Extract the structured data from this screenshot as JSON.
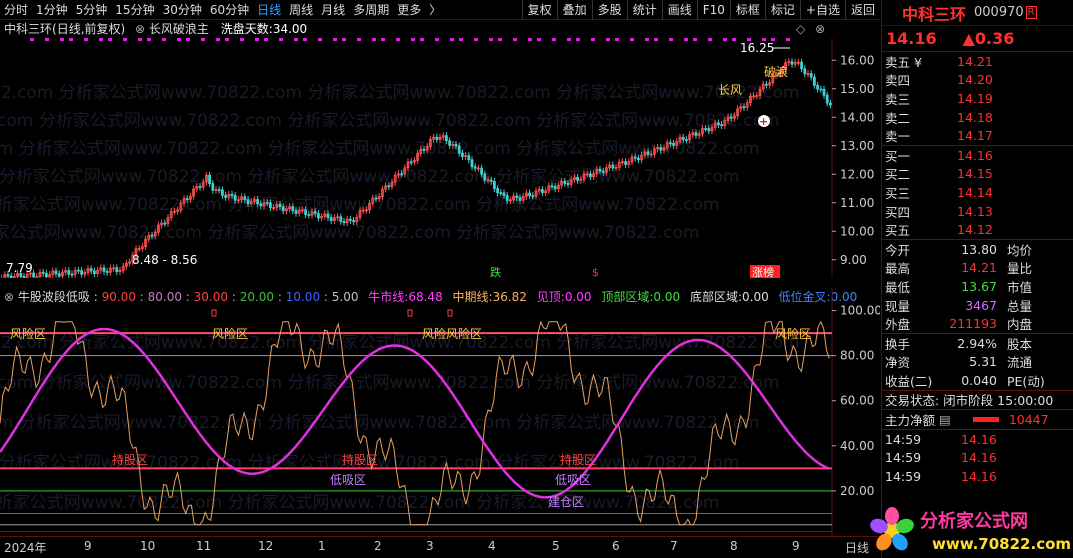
{
  "toolbar": {
    "left_tabs": [
      "分时",
      "1分钟",
      "5分钟",
      "15分钟",
      "30分钟",
      "60分钟",
      "日线",
      "周线",
      "月线",
      "多周期",
      "更多"
    ],
    "active": "日线",
    "more_arrow": "〉",
    "right_tabs": [
      "复权",
      "叠加",
      "多股",
      "统计",
      "画线",
      "F10",
      "标框",
      "标记",
      "+自选",
      "返回"
    ]
  },
  "kheader": {
    "stock": "中科三环",
    "mode": "(日线,前复权)",
    "indicator": "长风破浪主",
    "wash_label": "洗盘天数:",
    "wash_value": "34.00"
  },
  "kchart": {
    "y_ticks": [
      "16.00",
      "15.00",
      "14.00",
      "13.00",
      "12.00",
      "11.00",
      "10.00",
      "9.00"
    ],
    "high_label": "16.25",
    "low_label": "7.79",
    "range_label": "8.48 - 8.56",
    "tags": {
      "changfeng": "长风",
      "polang": "破浪",
      "die": "跌",
      "zhang": "涨榜"
    },
    "watermark": "22.com 分析家公式网www.70822.com 分析家公式网www.70822.com 分析家公式网www.70822.com"
  },
  "iheader": {
    "name": "牛股波段低吸",
    "levels": [
      {
        "v": "90.00",
        "c": "#ff4040"
      },
      {
        "v": "80.00",
        "c": "#c080c0"
      },
      {
        "v": "30.00",
        "c": "#ff4040"
      },
      {
        "v": "20.00",
        "c": "#40c040"
      },
      {
        "v": "10.00",
        "c": "#4060ff"
      },
      {
        "v": "5.00",
        "c": "#c0c0c0"
      }
    ],
    "niushi_label": "牛市线:",
    "niushi": "68.48",
    "zhongqi_label": "中期线:",
    "zhongqi": "36.82",
    "jianding_label": "见顶:",
    "jianding": "0.00",
    "dingbu_label": "顶部区域:",
    "dingbu": "0.00",
    "dibu_label": "底部区域:",
    "dibu": "0.00",
    "diwei_label": "低位金叉:",
    "diwei": "0.00"
  },
  "ind": {
    "y_ticks": [
      "100.00",
      "80.00",
      "60.00",
      "40.00",
      "20.00"
    ],
    "labels": {
      "risk": "风险区",
      "risk2": "风险区",
      "risk3": "风险风险区",
      "risk4": "风险区",
      "low": "低吸区",
      "low2": "低吸区",
      "build": "建仓区",
      "hold": "持股区",
      "low3": "低吸区",
      "hold2": "持股区",
      "hold3": "持股区"
    }
  },
  "xaxis": {
    "labels": [
      "2024年",
      "9",
      "10",
      "11",
      "12",
      "1",
      "2",
      "3",
      "4",
      "5",
      "6",
      "7",
      "8",
      "9"
    ],
    "tail": "日线"
  },
  "rp": {
    "name": "中科三环",
    "code": "000970",
    "badge": "R",
    "price": "14.16",
    "change": "▲0.36",
    "asks": [
      {
        "l": "卖五 ¥",
        "v": "14.21"
      },
      {
        "l": "卖四",
        "v": "14.20"
      },
      {
        "l": "卖三",
        "v": "14.19"
      },
      {
        "l": "卖二",
        "v": "14.18"
      },
      {
        "l": "卖一",
        "v": "14.17"
      }
    ],
    "bids": [
      {
        "l": "买一",
        "v": "14.16"
      },
      {
        "l": "买二",
        "v": "14.15"
      },
      {
        "l": "买三",
        "v": "14.14"
      },
      {
        "l": "买四",
        "v": "14.13"
      },
      {
        "l": "买五",
        "v": "14.12"
      }
    ],
    "stats": [
      {
        "l": "今开",
        "v": "13.80",
        "c": "#ddd",
        "l2": "均价"
      },
      {
        "l": "最高",
        "v": "14.21",
        "c": "#ff3030",
        "l2": "量比"
      },
      {
        "l": "最低",
        "v": "13.67",
        "c": "#40e040",
        "l2": "市值"
      },
      {
        "l": "现量",
        "v": "3467",
        "c": "#d070ff",
        "l2": "总量"
      },
      {
        "l": "外盘",
        "v": "211193",
        "c": "#ff3030",
        "l2": "内盘"
      }
    ],
    "stats2": [
      {
        "l": "换手",
        "v": "2.94%",
        "c": "#ddd",
        "l2": "股本"
      },
      {
        "l": "净资",
        "v": "5.31",
        "c": "#ddd",
        "l2": "流通"
      },
      {
        "l": "收益(二)",
        "v": "0.040",
        "c": "#ddd",
        "l2": "PE(动)"
      }
    ],
    "trade_state": "交易状态: 闭市阶段 15:00:00",
    "main_flow_label": "主力净额",
    "main_flow_value": "10447",
    "ticks": [
      {
        "t": "14:59",
        "p": "14.16"
      },
      {
        "t": "14:59",
        "p": "14.16"
      },
      {
        "t": "14:59",
        "p": "14.16"
      }
    ],
    "logo_text": "分析家公式网",
    "logo_url": "www.70822.com"
  }
}
